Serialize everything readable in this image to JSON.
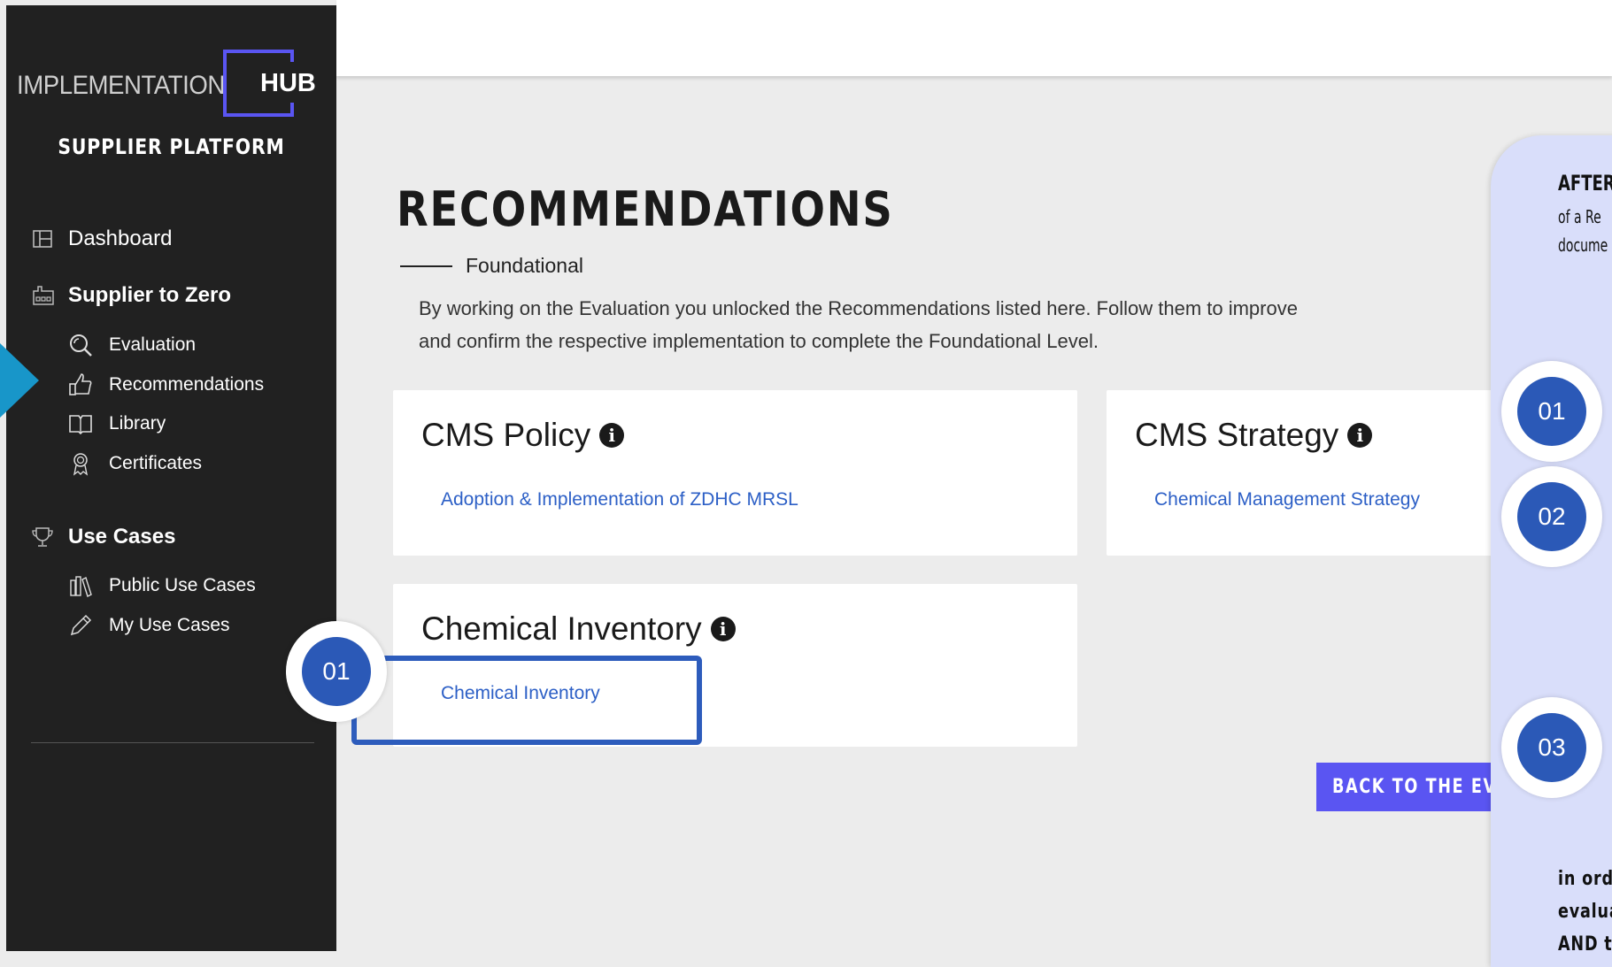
{
  "sidebar": {
    "logo_left": "IMPLEMENTATION",
    "logo_right": "HUB",
    "platform": "SUPPLIER PLATFORM",
    "dashboard": "Dashboard",
    "supplier_to_zero": "Supplier to Zero",
    "evaluation": "Evaluation",
    "recommendations": "Recommendations",
    "library": "Library",
    "certificates": "Certificates",
    "use_cases": "Use Cases",
    "public_use_cases": "Public Use Cases",
    "my_use_cases": "My Use Cases"
  },
  "main": {
    "title": "RECOMMENDATIONS",
    "subtitle": "Foundational",
    "intro_line1": "By working on the Evaluation you unlocked the Recommendations listed here. Follow them to improve",
    "intro_line2": "and confirm the respective implementation to complete the Foundational Level.",
    "cards": [
      {
        "title": "CMS Policy",
        "link": "Adoption & Implementation of ZDHC MRSL"
      },
      {
        "title": "CMS Strategy",
        "link": "Chemical Management Strategy"
      },
      {
        "title": "Chemical Inventory",
        "link": "Chemical Inventory"
      }
    ],
    "back_button": "BACK TO THE EV",
    "info_glyph": "i"
  },
  "annotations": {
    "main_step": "01",
    "panel_steps": [
      "01",
      "02",
      "03"
    ]
  },
  "panel": {
    "head": "AFTER",
    "line1": "of a Re",
    "line2": "docume",
    "bottom1": "in ord",
    "bottom2": "evalua",
    "bottom3": "AND t"
  },
  "colors": {
    "accent": "#5a55f2",
    "step_blue": "#2b59b7",
    "arrow": "#1896c9",
    "panel_bg": "#d9defa",
    "link": "#2c5fc6"
  }
}
